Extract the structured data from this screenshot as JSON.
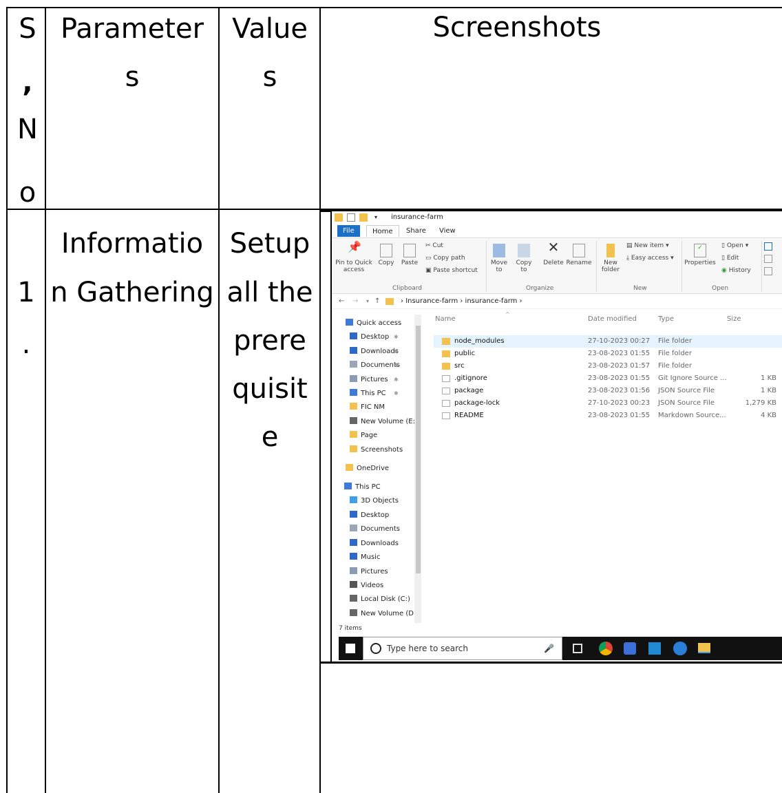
{
  "table": {
    "headers": {
      "sno": [
        "S",
        ",",
        "N",
        "o"
      ],
      "parameters": [
        "Parameter",
        "s"
      ],
      "values": [
        "Value",
        "s"
      ],
      "screenshots": "Screenshots"
    },
    "row1": {
      "sno": [
        "1",
        "."
      ],
      "parameter": [
        "Informatio",
        "n Gathering"
      ],
      "value": [
        "Setup",
        "all the",
        "prere",
        "quisit",
        "e"
      ]
    }
  },
  "explorer": {
    "title": "insurance-farm",
    "tabs": [
      "File",
      "Home",
      "Share",
      "View"
    ],
    "ribbon": {
      "pin": [
        "Pin to Quick",
        "access"
      ],
      "copy": "Copy",
      "paste": "Paste",
      "cut": "Cut",
      "copy_path": "Copy path",
      "paste_shortcut": "Paste shortcut",
      "clipboard": "Clipboard",
      "move_to": [
        "Move",
        "to"
      ],
      "copy_to": [
        "Copy",
        "to"
      ],
      "delete": "Delete",
      "rename": "Rename",
      "organize": "Organize",
      "new_folder": [
        "New",
        "folder"
      ],
      "new_item": "New item",
      "easy_access": "Easy access",
      "new": "New",
      "properties": "Properties",
      "open_btn": "Open",
      "edit": "Edit",
      "history": "History",
      "open": "Open"
    },
    "address": [
      "Insurance-farm",
      "insurance-farm"
    ],
    "columns": [
      "Name",
      "Date modified",
      "Type",
      "Size"
    ],
    "nav": [
      {
        "label": "Quick access",
        "icon": "star-icon"
      },
      {
        "label": "Desktop",
        "icon": "desktop-icon"
      },
      {
        "label": "Downloads",
        "icon": "download-icon"
      },
      {
        "label": "Documents",
        "icon": "document-icon"
      },
      {
        "label": "Pictures",
        "icon": "pictures-icon"
      },
      {
        "label": "This PC",
        "icon": "pc-icon"
      },
      {
        "label": "FIC NM",
        "icon": "folder-icon"
      },
      {
        "label": "New Volume (E:)",
        "icon": "drive-icon"
      },
      {
        "label": "Page",
        "icon": "folder-icon"
      },
      {
        "label": "Screenshots",
        "icon": "folder-icon"
      },
      {
        "label": "OneDrive",
        "icon": "folder-icon"
      },
      {
        "label": "This PC",
        "icon": "pc-icon"
      },
      {
        "label": "3D Objects",
        "icon": "cube-icon"
      },
      {
        "label": "Desktop",
        "icon": "desktop-icon"
      },
      {
        "label": "Documents",
        "icon": "document-icon"
      },
      {
        "label": "Downloads",
        "icon": "download-icon"
      },
      {
        "label": "Music",
        "icon": "music-icon"
      },
      {
        "label": "Pictures",
        "icon": "pictures-icon"
      },
      {
        "label": "Videos",
        "icon": "video-icon"
      },
      {
        "label": "Local Disk (C:)",
        "icon": "drive-icon"
      },
      {
        "label": "New Volume (D:",
        "icon": "drive-icon"
      }
    ],
    "files": [
      {
        "name": "node_modules",
        "date": "27-10-2023 00:27",
        "type": "File folder",
        "size": ""
      },
      {
        "name": "public",
        "date": "23-08-2023 01:55",
        "type": "File folder",
        "size": ""
      },
      {
        "name": "src",
        "date": "23-08-2023 01:57",
        "type": "File folder",
        "size": ""
      },
      {
        "name": ".gitignore",
        "date": "23-08-2023 01:55",
        "type": "Git Ignore Source ...",
        "size": "1 KB"
      },
      {
        "name": "package",
        "date": "23-08-2023 01:56",
        "type": "JSON Source File",
        "size": "1 KB"
      },
      {
        "name": "package-lock",
        "date": "27-10-2023 00:23",
        "type": "JSON Source File",
        "size": "1,279 KB"
      },
      {
        "name": "README",
        "date": "23-08-2023 01:55",
        "type": "Markdown Source...",
        "size": "4 KB"
      }
    ],
    "status": "7 items",
    "search_placeholder": "Type here to search"
  }
}
